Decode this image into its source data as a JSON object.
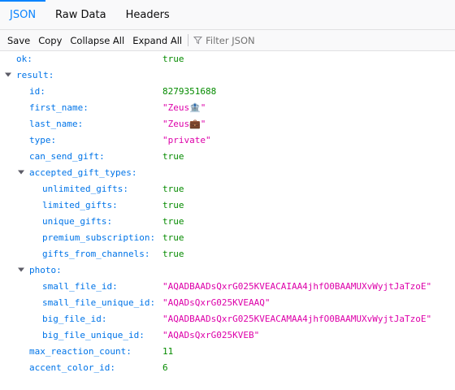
{
  "tabs": [
    {
      "label": "JSON",
      "selected": true
    },
    {
      "label": "Raw Data",
      "selected": false
    },
    {
      "label": "Headers",
      "selected": false
    }
  ],
  "toolbar": {
    "save": "Save",
    "copy": "Copy",
    "collapse_all": "Collapse All",
    "expand_all": "Expand All",
    "filter_placeholder": "Filter JSON",
    "filter_icon": "filter-icon"
  },
  "colors": {
    "accent": "#0a84ff",
    "key": "#0074e8",
    "number": "#058b00",
    "string": "#dd00a9"
  },
  "tree": {
    "ok": {
      "key": "ok:",
      "value": "true"
    },
    "result": {
      "key": "result:"
    },
    "id": {
      "key": "id:",
      "value": "8279351688"
    },
    "first_name": {
      "key": "first_name:",
      "value": "\"Zeus🏦\""
    },
    "last_name": {
      "key": "last_name:",
      "value": "\"Zeus💼\""
    },
    "type": {
      "key": "type:",
      "value": "\"private\""
    },
    "can_send_gift": {
      "key": "can_send_gift:",
      "value": "true"
    },
    "accepted_gift_types": {
      "key": "accepted_gift_types:"
    },
    "unlimited_gifts": {
      "key": "unlimited_gifts:",
      "value": "true"
    },
    "limited_gifts": {
      "key": "limited_gifts:",
      "value": "true"
    },
    "unique_gifts": {
      "key": "unique_gifts:",
      "value": "true"
    },
    "premium_subscription": {
      "key": "premium_subscription:",
      "value": "true"
    },
    "gifts_from_channels": {
      "key": "gifts_from_channels:",
      "value": "true"
    },
    "photo": {
      "key": "photo:"
    },
    "small_file_id": {
      "key": "small_file_id:",
      "value": "\"AQADBAADsQxrG025KVEACAIAA4jhfO0BAAMUXvWyjtJaTzoE\""
    },
    "small_file_unique_id": {
      "key": "small_file_unique_id:",
      "value": "\"AQADsQxrG025KVEAAQ\""
    },
    "big_file_id": {
      "key": "big_file_id:",
      "value": "\"AQADBAADsQxrG025KVEACAMAA4jhfO0BAAMUXvWyjtJaTzoE\""
    },
    "big_file_unique_id": {
      "key": "big_file_unique_id:",
      "value": "\"AQADsQxrG025KVEB\""
    },
    "max_reaction_count": {
      "key": "max_reaction_count:",
      "value": "11"
    },
    "accent_color_id": {
      "key": "accent_color_id:",
      "value": "6"
    }
  }
}
